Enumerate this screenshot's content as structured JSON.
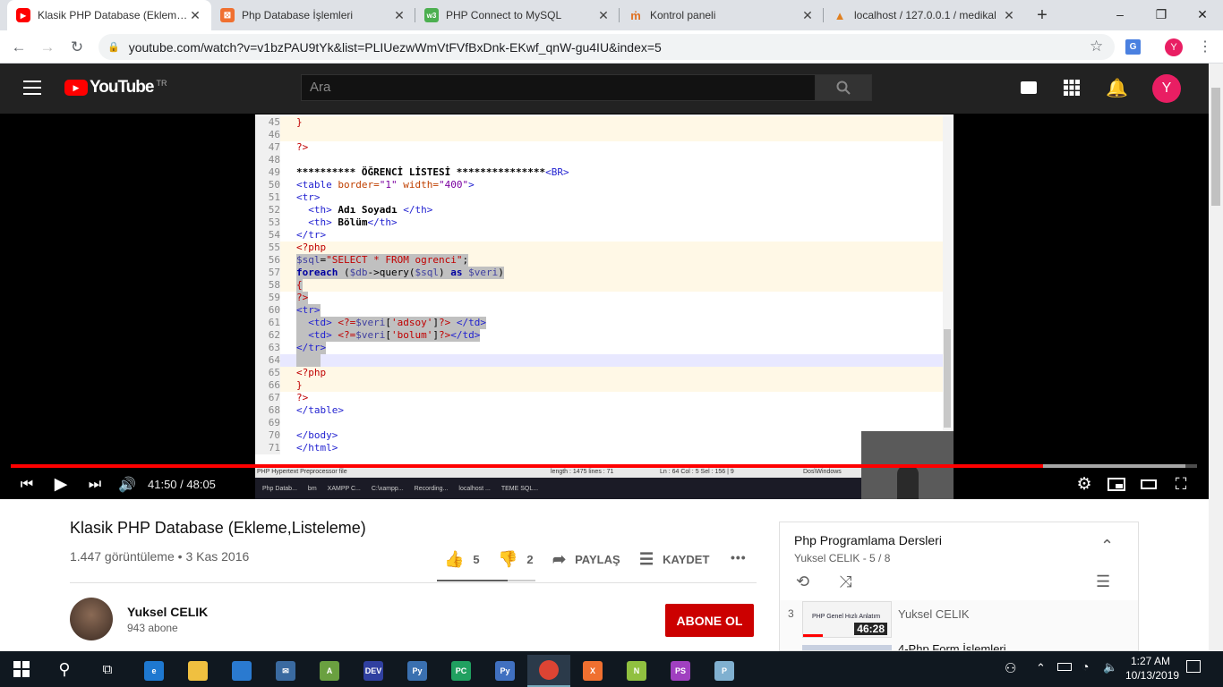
{
  "browser": {
    "tabs": [
      {
        "title": "Klasik PHP Database (Ekleme,Listeleme)",
        "icon": "youtube-icon",
        "active": true
      },
      {
        "title": "Php Database İşlemleri",
        "icon": "xampp-icon",
        "active": false
      },
      {
        "title": "PHP Connect to MySQL",
        "icon": "w3schools-icon",
        "active": false
      },
      {
        "title": "Kontrol paneli",
        "icon": "hosting-icon",
        "active": false
      },
      {
        "title": "localhost / 127.0.0.1 / medikal",
        "icon": "phpmyadmin-icon",
        "active": false
      }
    ],
    "new_tab": "+",
    "url": "youtube.com/watch?v=v1bzPAU9tYk&list=PLIUezwWmVtFVfBxDnk-EKwf_qnW-gu4IU&index=5",
    "profile_initial": "Y",
    "window_controls": {
      "minimize": "–",
      "maximize": "❐",
      "close": "✕"
    }
  },
  "youtube": {
    "logo_text": "YouTube",
    "region": "TR",
    "search_placeholder": "Ara",
    "avatar_initial": "Y"
  },
  "editor": {
    "lines": [
      {
        "n": "45",
        "html": "<span class=\"ph\">}</span>",
        "cls": "hl"
      },
      {
        "n": "46",
        "html": "",
        "cls": "hl"
      },
      {
        "n": "47",
        "html": "<span class=\"ph\">?&gt;</span>",
        "cls": ""
      },
      {
        "n": "48",
        "html": "",
        "cls": ""
      },
      {
        "n": "49",
        "html": "<b>********** ÖĞRENCİ LİSTESİ ***************</b><span class=\"tg\">&lt;BR&gt;</span>",
        "cls": ""
      },
      {
        "n": "50",
        "html": "<span class=\"tg\">&lt;table</span> <span class=\"at\">border=</span><span class=\"st\">\"1\"</span> <span class=\"at\">width=</span><span class=\"st\">\"400\"</span><span class=\"tg\">&gt;</span>",
        "cls": ""
      },
      {
        "n": "51",
        "html": "<span class=\"tg\">&lt;tr&gt;</span>",
        "cls": ""
      },
      {
        "n": "52",
        "html": "  <span class=\"tg\">&lt;th&gt;</span> <b>Adı Soyadı</b> <span class=\"tg\">&lt;/th&gt;</span>",
        "cls": ""
      },
      {
        "n": "53",
        "html": "  <span class=\"tg\">&lt;th&gt;</span> <b>Bölüm</b><span class=\"tg\">&lt;/th&gt;</span>",
        "cls": ""
      },
      {
        "n": "54",
        "html": "<span class=\"tg\">&lt;/tr&gt;</span>",
        "cls": ""
      },
      {
        "n": "55",
        "html": "<span class=\"ph\">&lt;?php</span>",
        "cls": "hl"
      },
      {
        "n": "56",
        "html": "<span class=\"vr\">$sql</span>=<span class=\"ph\">\"SELECT * FROM ogrenci\"</span>;",
        "cls": "hl sel"
      },
      {
        "n": "57",
        "html": "<span class=\"kw\">foreach</span> (<span class=\"vr\">$db</span>-&gt;query(<span class=\"vr\">$sql</span>) <span class=\"kw\">as</span> <span class=\"vr\">$veri</span>)",
        "cls": "hl sel"
      },
      {
        "n": "58",
        "html": "<span class=\"ph\">{</span>",
        "cls": "hl sel"
      },
      {
        "n": "59",
        "html": "<span class=\"ph\">?&gt;</span>",
        "cls": "sel"
      },
      {
        "n": "60",
        "html": "<span class=\"tg\">&lt;tr&gt;</span>",
        "cls": "sel"
      },
      {
        "n": "61",
        "html": "  <span class=\"tg\">&lt;td&gt;</span> <span class=\"ph\">&lt;?=</span><span class=\"vr\">$veri</span>[<span class=\"ph\">'adsoy'</span>]<span class=\"ph\">?&gt;</span> <span class=\"tg\">&lt;/td&gt;</span>",
        "cls": "sel"
      },
      {
        "n": "62",
        "html": "  <span class=\"tg\">&lt;td&gt;</span> <span class=\"ph\">&lt;?=</span><span class=\"vr\">$veri</span>[<span class=\"ph\">'bolum'</span>]<span class=\"ph\">?&gt;</span><span class=\"tg\">&lt;/td&gt;</span>",
        "cls": "sel"
      },
      {
        "n": "63",
        "html": "<span class=\"tg\">&lt;/tr&gt;</span>",
        "cls": "sel"
      },
      {
        "n": "64",
        "html": "    ",
        "cls": "cur sel"
      },
      {
        "n": "65",
        "html": "<span class=\"ph\">&lt;?php</span>",
        "cls": "hl"
      },
      {
        "n": "66",
        "html": "<span class=\"ph\">}</span>",
        "cls": "hl"
      },
      {
        "n": "67",
        "html": "<span class=\"ph\">?&gt;</span>",
        "cls": ""
      },
      {
        "n": "68",
        "html": "<span class=\"tg\">&lt;/table&gt;</span>",
        "cls": ""
      },
      {
        "n": "69",
        "html": "",
        "cls": ""
      },
      {
        "n": "70",
        "html": "<span class=\"tg\">&lt;/body&gt;</span>",
        "cls": ""
      },
      {
        "n": "71",
        "html": "<span class=\"tg\">&lt;/html&gt;</span>",
        "cls": ""
      }
    ],
    "status_left": "PHP Hypertext Preprocessor file",
    "status_mid": "length : 1475    lines : 71",
    "status_pos": "Ln : 64    Col : 5    Sel : 156 | 9",
    "status_right": "Dos\\Windows",
    "inner_taskbar": [
      "Php Datab...",
      "bm",
      "XAMPP C...",
      "C:\\xampp...",
      "Recording...",
      "localhost ...",
      "TEME SQL..."
    ]
  },
  "player": {
    "time": "41:50 / 48:05",
    "progress_fraction": 0.87,
    "buffered_fraction": 0.99
  },
  "video": {
    "title": "Klasik PHP Database (Ekleme,Listeleme)",
    "views": "1.447 görüntüleme",
    "date": "3 Kas 2016",
    "likes": "5",
    "dislikes": "2",
    "share": "PAYLAŞ",
    "save": "KAYDET",
    "more": "•••",
    "channel": "Yuksel CELIK",
    "subscribers": "943 abone",
    "subscribe": "ABONE OL"
  },
  "playlist": {
    "title": "Php Programlama Dersleri",
    "subtitle": "Yuksel CELIK - 5 / 8",
    "item_index": "3",
    "item_thumb_text": "PHP Genel Hızlı Anlatım",
    "item_duration": "46:28",
    "item_author": "Yuksel CELIK",
    "next_title": "4-Php Form İşlemleri"
  },
  "taskbar": {
    "time": "1:27 AM",
    "date": "10/13/2019",
    "apps": [
      {
        "name": "edge-icon",
        "label": "e",
        "color": "#1e78d0"
      },
      {
        "name": "file-explorer-icon",
        "label": "",
        "color": "#f0c040"
      },
      {
        "name": "store-icon",
        "label": "",
        "color": "#2a7ad0"
      },
      {
        "name": "mail-icon",
        "label": "✉",
        "color": "#3a6aa0"
      },
      {
        "name": "android-icon",
        "label": "A",
        "color": "#6aa040"
      },
      {
        "name": "devcpp-icon",
        "label": "DEV",
        "color": "#3040a0"
      },
      {
        "name": "python-icon",
        "label": "Py",
        "color": "#3a70b0"
      },
      {
        "name": "pycharm-icon",
        "label": "PC",
        "color": "#20a060"
      },
      {
        "name": "python-idle-icon",
        "label": "Py",
        "color": "#4070c0"
      },
      {
        "name": "chrome-icon",
        "label": "",
        "color": "#dd4433"
      },
      {
        "name": "xampp-icon",
        "label": "X",
        "color": "#f07030"
      },
      {
        "name": "notepad-icon",
        "label": "N",
        "color": "#90c040"
      },
      {
        "name": "phpstorm-icon",
        "label": "PS",
        "color": "#a040c0"
      },
      {
        "name": "paint-icon",
        "label": "P",
        "color": "#80b0d0"
      }
    ]
  },
  "colors": {
    "youtube_red": "#ff0000",
    "subscribe_red": "#cc0000",
    "youtube_dark": "#222222"
  }
}
